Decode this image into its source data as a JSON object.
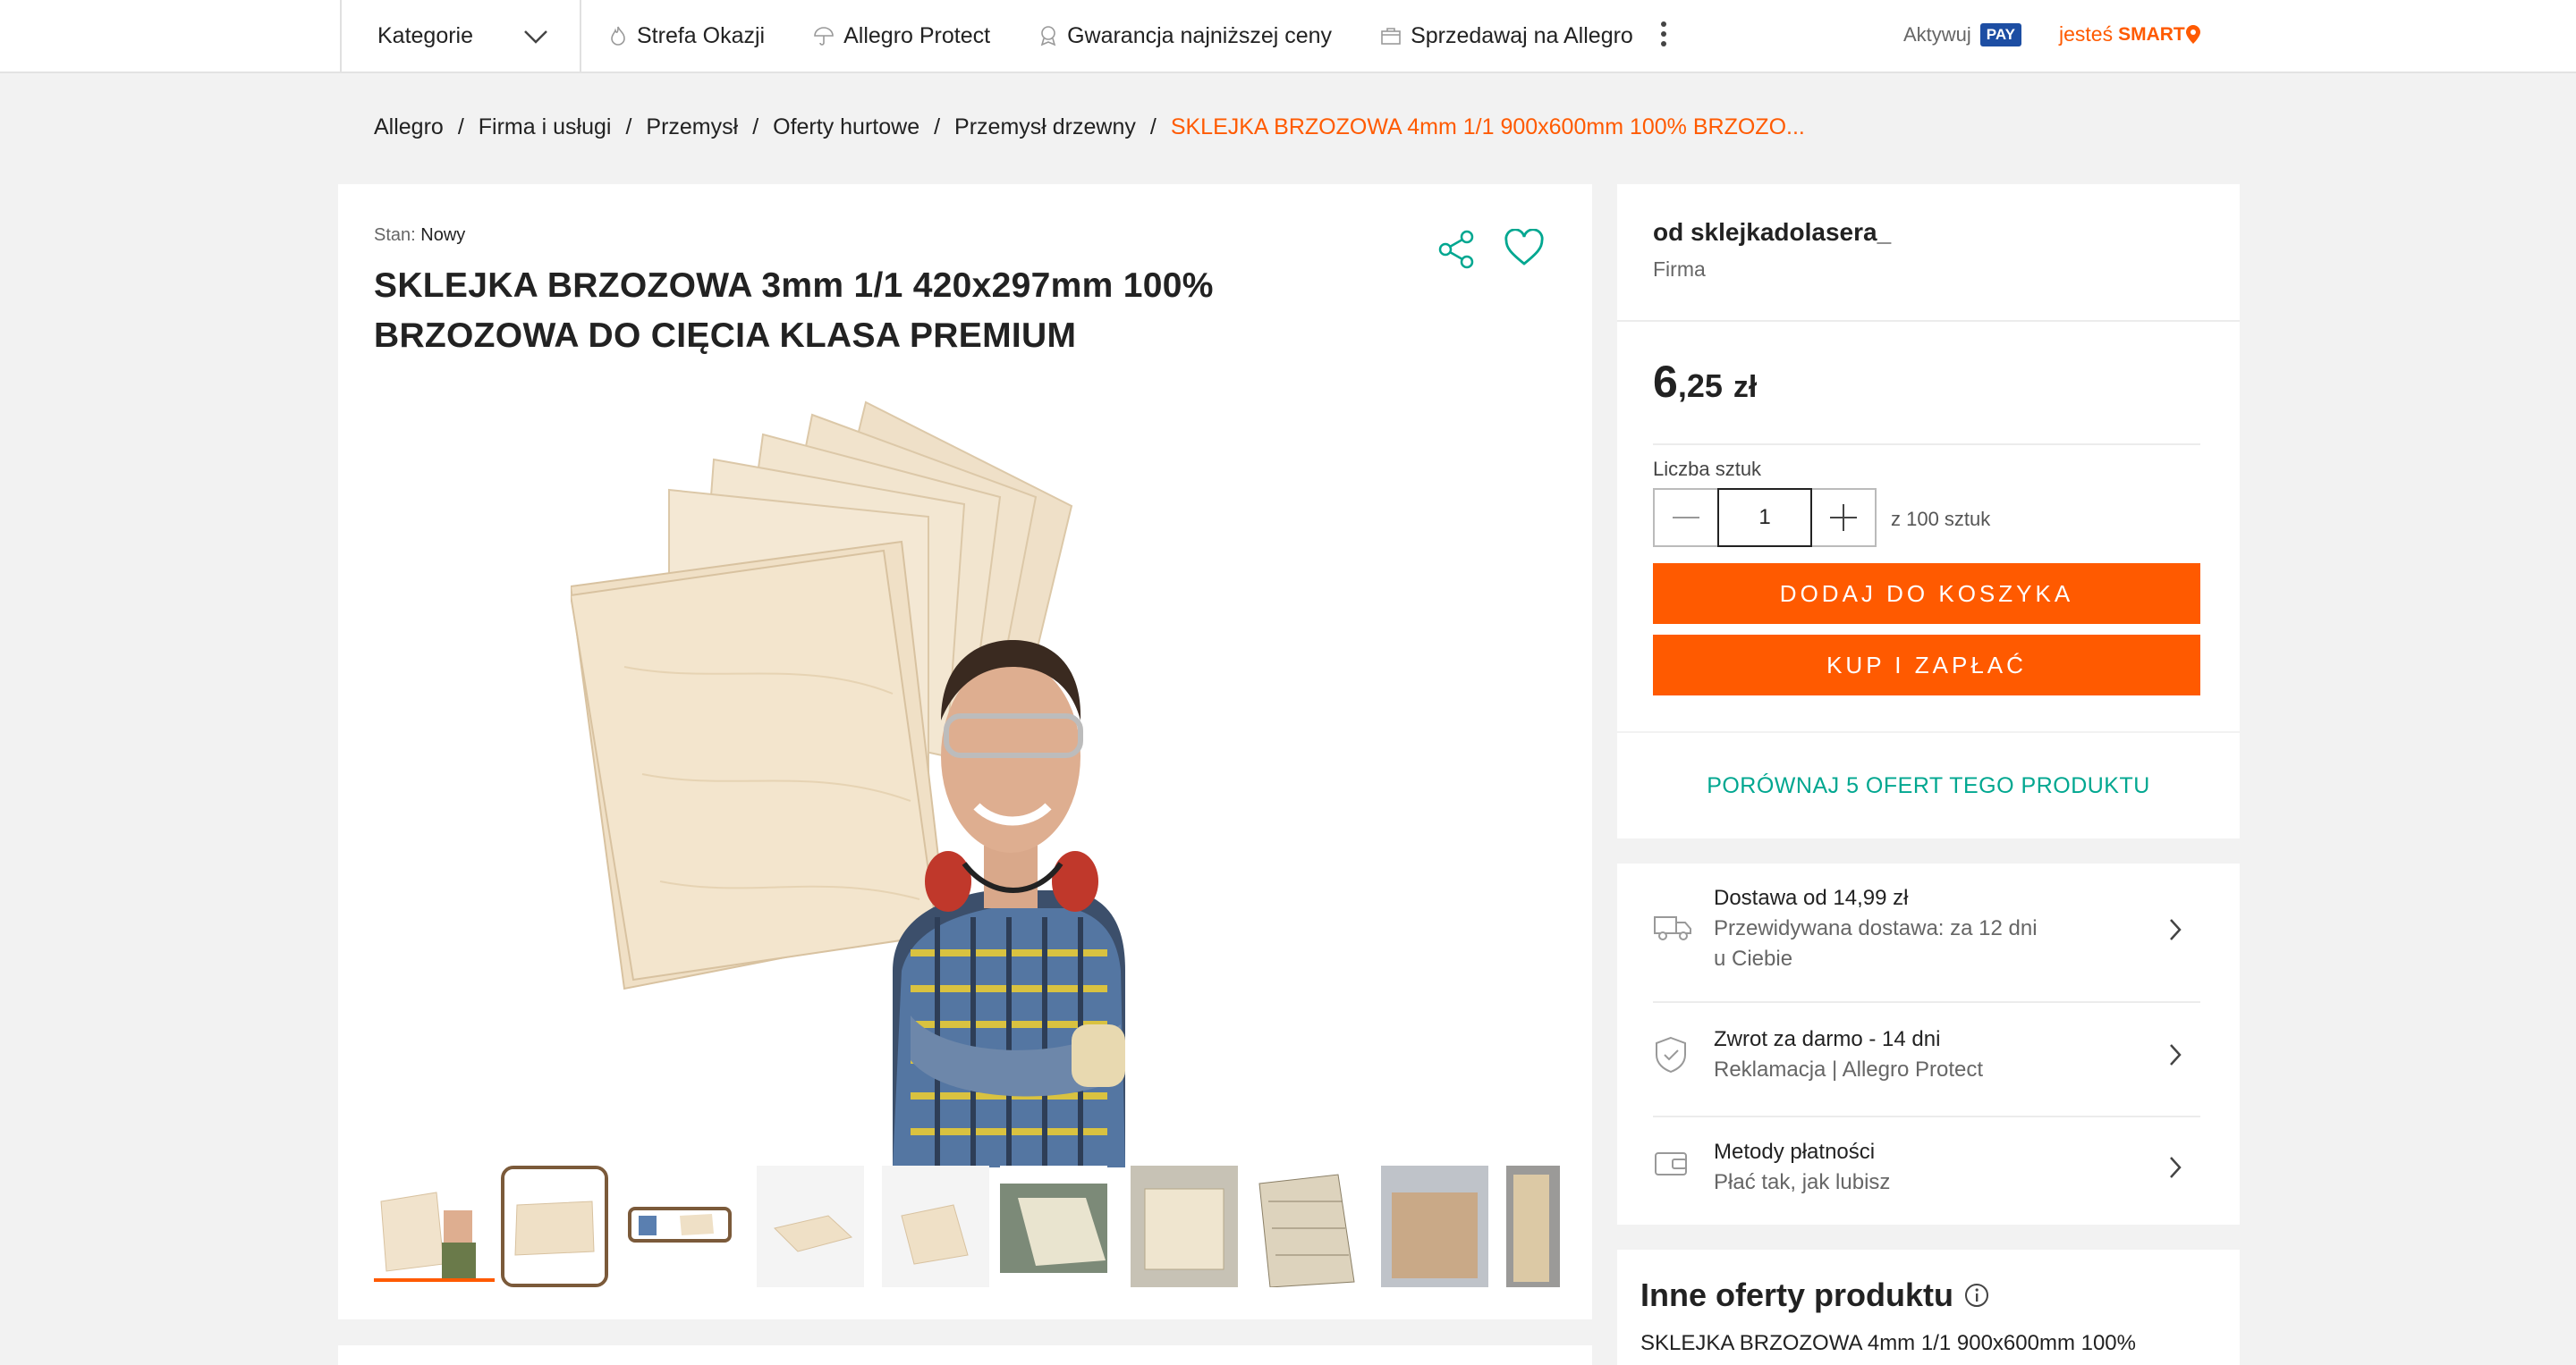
{
  "topbar": {
    "categories_label": "Kategorie",
    "links": [
      {
        "label": "Strefa Okazji",
        "icon": "flame-icon"
      },
      {
        "label": "Allegro Protect",
        "icon": "umbrella-icon"
      },
      {
        "label": "Gwarancja najniższej ceny",
        "icon": "badge-icon"
      },
      {
        "label": "Sprzedawaj na Allegro",
        "icon": "store-icon"
      }
    ],
    "aktywuj": "Aktywuj",
    "pay_badge": "PAY",
    "smart_prefix": "jesteś",
    "smart_label": "SMART"
  },
  "breadcrumb": {
    "items": [
      "Allegro",
      "Firma i usługi",
      "Przemysł",
      "Oferty hurtowe",
      "Przemysł drzewny"
    ],
    "separator": "/",
    "current": "SKLEJKA BRZOZOWA 4mm 1/1 900x600mm 100% BRZOZO..."
  },
  "product": {
    "condition_label": "Stan:",
    "condition_value": "Nowy",
    "title": "SKLEJKA BRZOZOWA 3mm 1/1 420x297mm 100% BRZOZOWA DO CIĘCIA KLASA PREMIUM",
    "thumbnail_count": 10,
    "selected_thumbnail": 1
  },
  "seller": {
    "name": "od sklejkadolasera_",
    "type": "Firma"
  },
  "pricing": {
    "price_int": "6",
    "price_dec": ",25",
    "currency": "zł",
    "quantity_label": "Liczba sztuk",
    "quantity_value": "1",
    "quantity_of": "z 100 sztuk",
    "add_to_cart": "DODAJ DO KOSZYKA",
    "buy_now": "KUP I ZAPŁAĆ"
  },
  "compare": {
    "label": "PORÓWNAJ 5 OFERT TEGO PRODUKTU"
  },
  "info_rows": [
    {
      "title": "Dostawa od 14,99 zł",
      "sub1": "Przewidywana dostawa: za 12 dni",
      "sub2": "u Ciebie",
      "icon": "truck-icon"
    },
    {
      "title": "Zwrot za darmo - 14 dni",
      "sub1": "Reklamacja | Allegro Protect",
      "icon": "shield-icon"
    },
    {
      "title": "Metody płatności",
      "sub1": "Płać tak, jak lubisz",
      "icon": "wallet-icon"
    }
  ],
  "other_offers": {
    "title": "Inne oferty produktu",
    "item_title": "SKLEJKA BRZOZOWA 4mm 1/1 900x600mm 100%"
  },
  "colors": {
    "accent": "#ff5a00",
    "teal": "#00a790",
    "background": "#f2f2f2"
  }
}
